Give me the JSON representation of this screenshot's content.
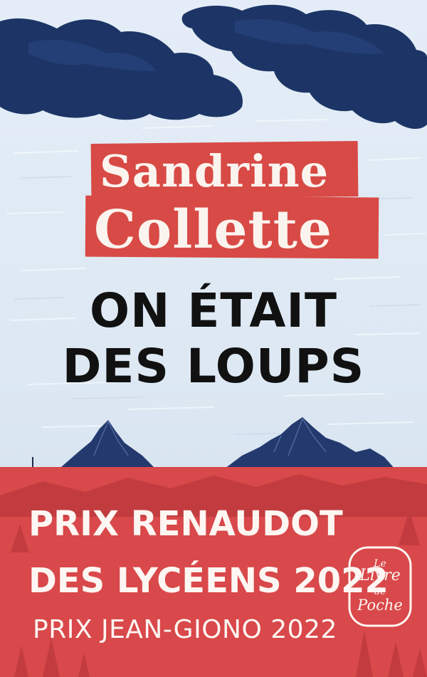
{
  "author": {
    "first_name": "Sandrine",
    "last_name": "Collette"
  },
  "title": {
    "line1": "ON ÉTAIT",
    "line2": "DES LOUPS"
  },
  "awards": {
    "line1": "PRIX RENAUDOT",
    "line2": "DES LYCÉENS 2022",
    "line3": "PRIX JEAN-GIONO 2022"
  },
  "publisher_logo": {
    "word1": "Le",
    "word2": "Livre",
    "word3": "de",
    "word4": "Poche"
  },
  "colors": {
    "sky": "#dfe9f4",
    "cloud": "#1c3566",
    "accent_red": "#d84a45",
    "title_text": "#111111",
    "mountain": "#243a6e"
  }
}
